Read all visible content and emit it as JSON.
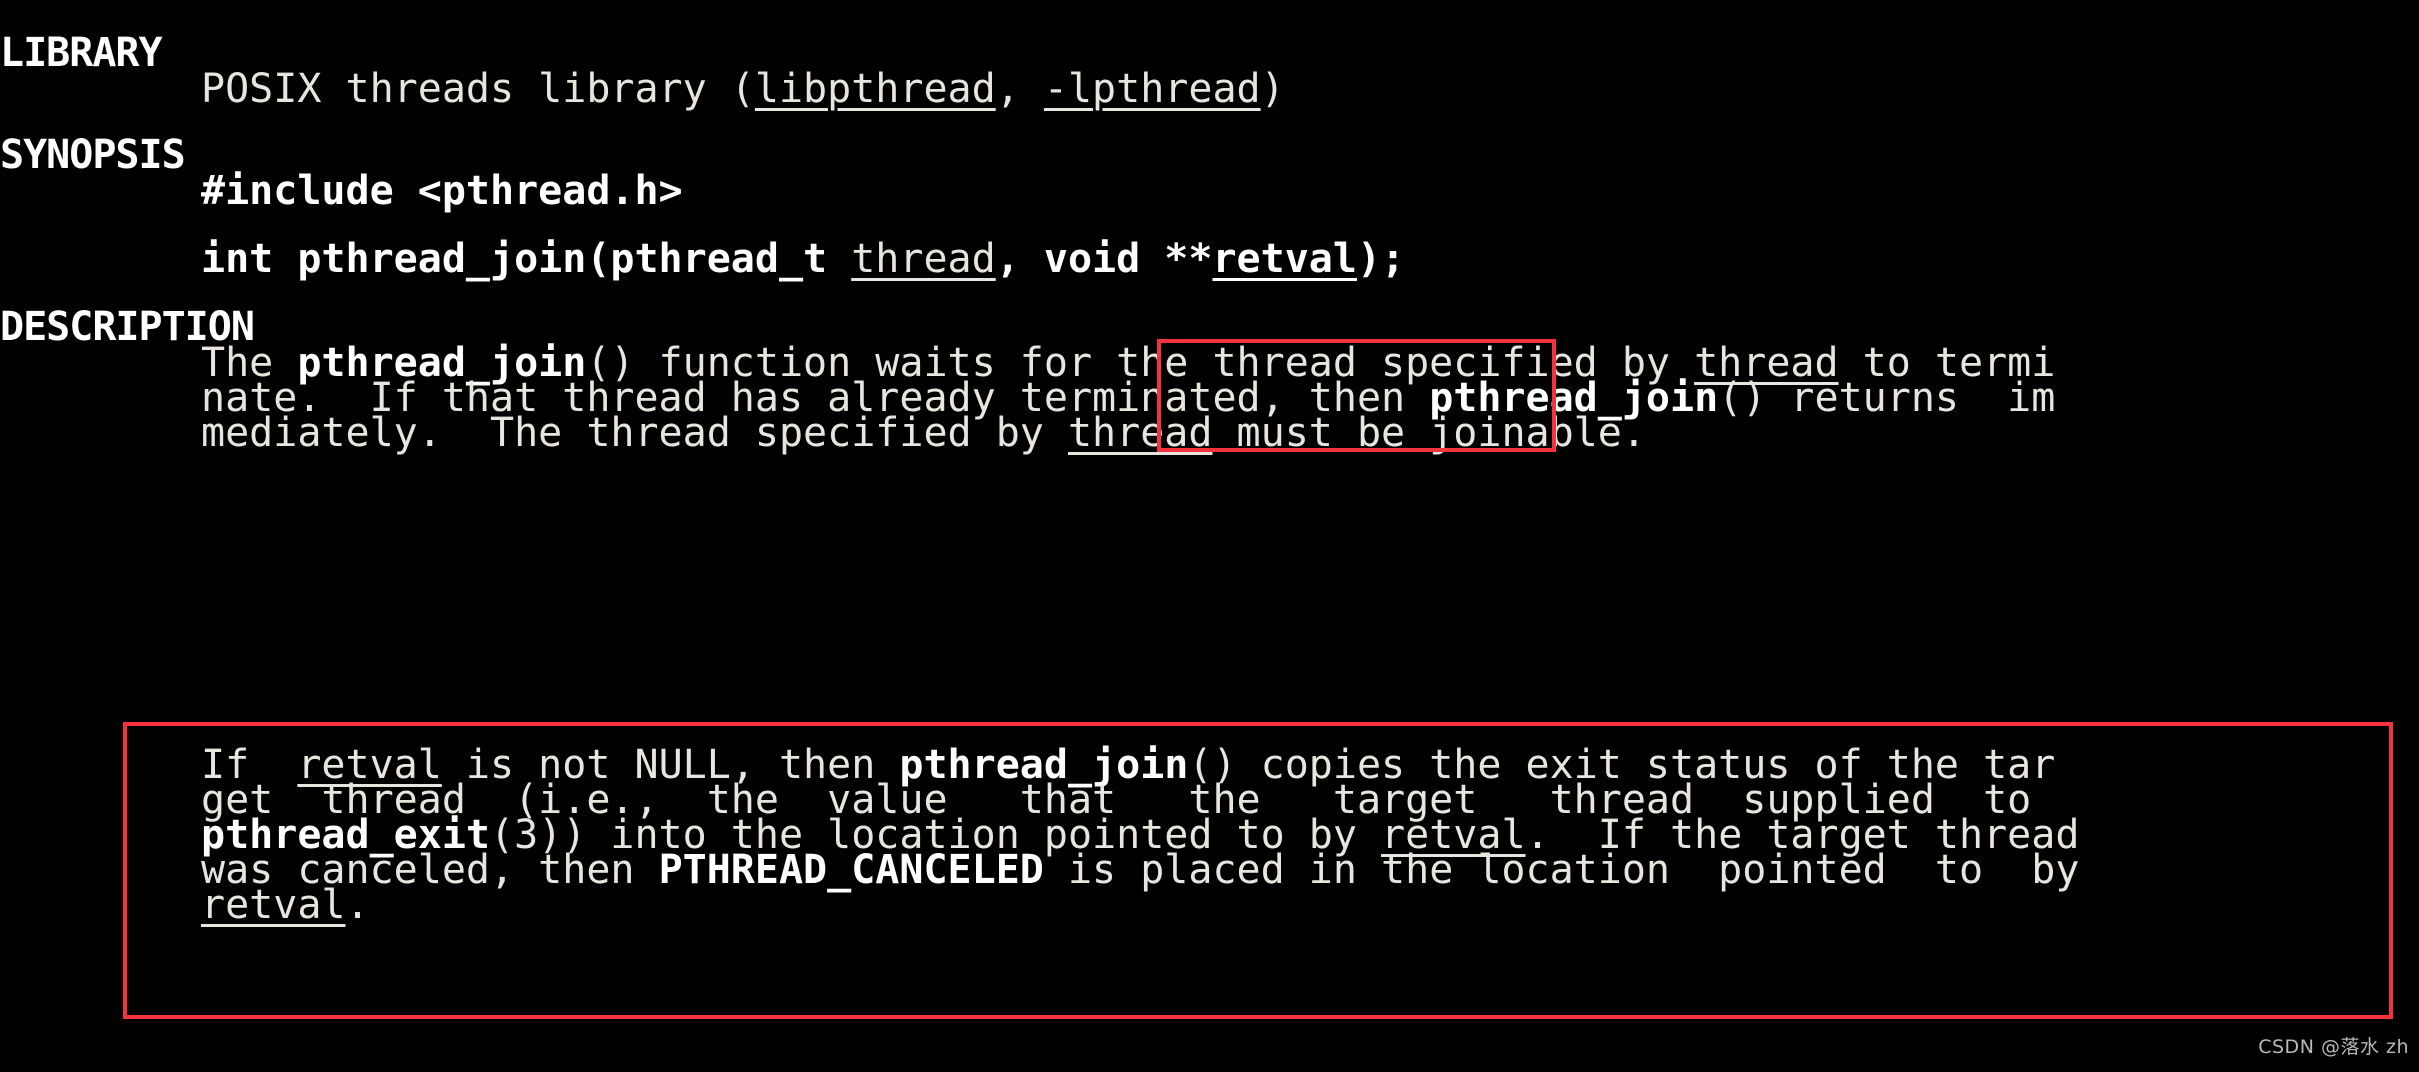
{
  "page": {
    "background_color": "#000000",
    "text_color": "#e8e4de",
    "annotation_color": "#f5333f"
  },
  "sections": {
    "library": {
      "heading": "LIBRARY",
      "body_prefix": "POSIX threads library (",
      "lib_name": "libpthread",
      "body_mid": ", ",
      "lib_flag": "-lpthread",
      "body_suffix": ")"
    },
    "synopsis": {
      "heading": "SYNOPSIS",
      "include_line": "#include <pthread.h>",
      "prototype": {
        "return_and_name": "int pthread_join(pthread_t ",
        "param1": "thread",
        "separator": ", ",
        "param2_type": "void **",
        "param2_name": "retval",
        "tail": ");"
      }
    },
    "description": {
      "heading": "DESCRIPTION",
      "paragraph1": {
        "line1_a": "The ",
        "line1_func": "pthread_join",
        "line1_b": "() function waits for the thread specified by ",
        "line1_arg": "thread",
        "line1_c": " to termi",
        "line2_a": "nate.  If that thread has already terminated, then ",
        "line2_func": "pthread_join",
        "line2_b": "() returns  im",
        "line3_a": "mediately.  The thread specified by ",
        "line3_arg": "thread",
        "line3_b": " must be joinable."
      },
      "paragraph2": {
        "line1_a": "If  ",
        "line1_arg": "retval",
        "line1_b": " is not NULL, then ",
        "line1_func": "pthread_join",
        "line1_c": "() copies the exit status of the tar",
        "line2": "get  thread  (i.e.,  the  value   that   the   target   thread  supplied  to",
        "line3_func": "pthread_exit",
        "line3_a": "(3)) into the location pointed to by ",
        "line3_arg": "retval",
        "line3_b": ".  If the target thread",
        "line4_a": "was canceled, then ",
        "line4_const": "PTHREAD_CANCELED",
        "line4_b": " is placed in the location  pointed  to  by",
        "line5_arg": "retval",
        "line5_b": "."
      }
    }
  },
  "annotations": {
    "box_retval_param_label": "retval-parameter-highlight",
    "box_retval_paragraph_label": "retval-description-highlight"
  },
  "watermark": {
    "text": "CSDN @落水 zh"
  }
}
